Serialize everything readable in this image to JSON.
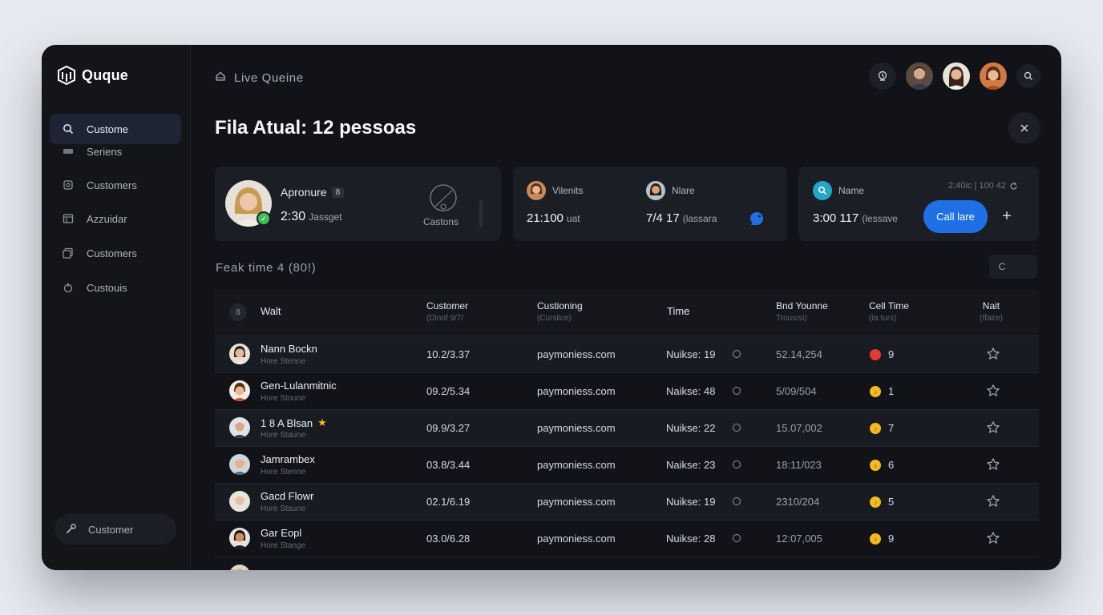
{
  "app": {
    "name": "Quque"
  },
  "sidebar": {
    "items": [
      {
        "label": "Custome",
        "icon": "search-icon",
        "active": true
      },
      {
        "label": "Seriens",
        "icon": "card-icon"
      },
      {
        "label": "Customers",
        "icon": "box-icon"
      },
      {
        "label": "Azzuidar",
        "icon": "calendar-icon"
      },
      {
        "label": "Customers",
        "icon": "users-icon"
      },
      {
        "label": "Custouis",
        "icon": "hand-icon"
      }
    ],
    "bottom_label": "Customer"
  },
  "header": {
    "breadcrumb": "Live Queine",
    "title": "Fila Atual: 12 pessoas"
  },
  "cards": {
    "c1": {
      "name": "Apronure",
      "tag": "8",
      "value": "2:30",
      "unit": "Jassget",
      "caption": "Castons"
    },
    "c2": {
      "left_name": "Vilenits",
      "left_value": "21:100",
      "left_unit": "uat",
      "right_name": "Nlare",
      "right_value": "7/4 17",
      "right_unit": "(lassara"
    },
    "c3": {
      "label": "Name",
      "meta": "2:40ic | 100 42",
      "value": "3:00 117",
      "unit": "(lessave",
      "button": "Call lare",
      "plus": "+"
    }
  },
  "section": {
    "title": "Feak time 4 (80!)",
    "button": "C"
  },
  "table": {
    "badge": "8",
    "headers": {
      "wait": "Walt",
      "customer": "Customer",
      "customer_sub": "(Dlnof 9/7/",
      "customing": "Custioning",
      "customing_sub": "(Curslice)",
      "time": "Time",
      "band": "Bnd Younne",
      "band_sub": "Trousrsi)",
      "call": "Cell Time",
      "call_sub": "(Ia turs)",
      "nait": "Nait",
      "nait_sub": "(Ifaire)"
    },
    "rows": [
      {
        "name": "Nann Bockn",
        "sub": "Hore Stenne",
        "date": "10.2/3.37",
        "domain": "paymoniess.com",
        "status": "Nuikse: 19",
        "when": "52.14,254",
        "dot_color": "#e53935",
        "count": "9",
        "starred": false
      },
      {
        "name": "Gen-Lulanmitnic",
        "sub": "Hore Stoune",
        "date": "09.2/5.34",
        "domain": "paymoniess.com",
        "status": "Naikse: 48",
        "when": "5/09/504",
        "dot_color": "#f5b922",
        "count": "1",
        "starred": false
      },
      {
        "name": "1 8 A Blsan",
        "sub": "Hore Staune",
        "date": "09.9/3.27",
        "domain": "paymoniess.com",
        "status": "Nuikse: 22",
        "when": "15.07,002",
        "dot_color": "#f5b922",
        "count": "7",
        "starred": true
      },
      {
        "name": "Jamrambex",
        "sub": "Hore Stenne",
        "date": "03.8/3.44",
        "domain": "paymoniess.com",
        "status": "Naikse: 23",
        "when": "18:11/023",
        "dot_color": "#f5b922",
        "count": "6",
        "starred": false
      },
      {
        "name": "Gacd Flowr",
        "sub": "Hore Staune",
        "date": "02.1/6.19",
        "domain": "paymoniess.com",
        "status": "Nuikse: 19",
        "when": "2310/204",
        "dot_color": "#f5b922",
        "count": "5",
        "starred": false
      },
      {
        "name": "Gar Eopl",
        "sub": "Hore Stange",
        "date": "03.0/6.28",
        "domain": "paymoniess.com",
        "status": "Nuikse: 28",
        "when": "12:07,005",
        "dot_color": "#f5b922",
        "count": "9",
        "starred": false
      }
    ]
  },
  "colors": {
    "accent": "#1f6fe5",
    "online": "#3fbf5a",
    "warn": "#f5b922",
    "alert": "#e53935",
    "teal": "#22a7c4"
  }
}
